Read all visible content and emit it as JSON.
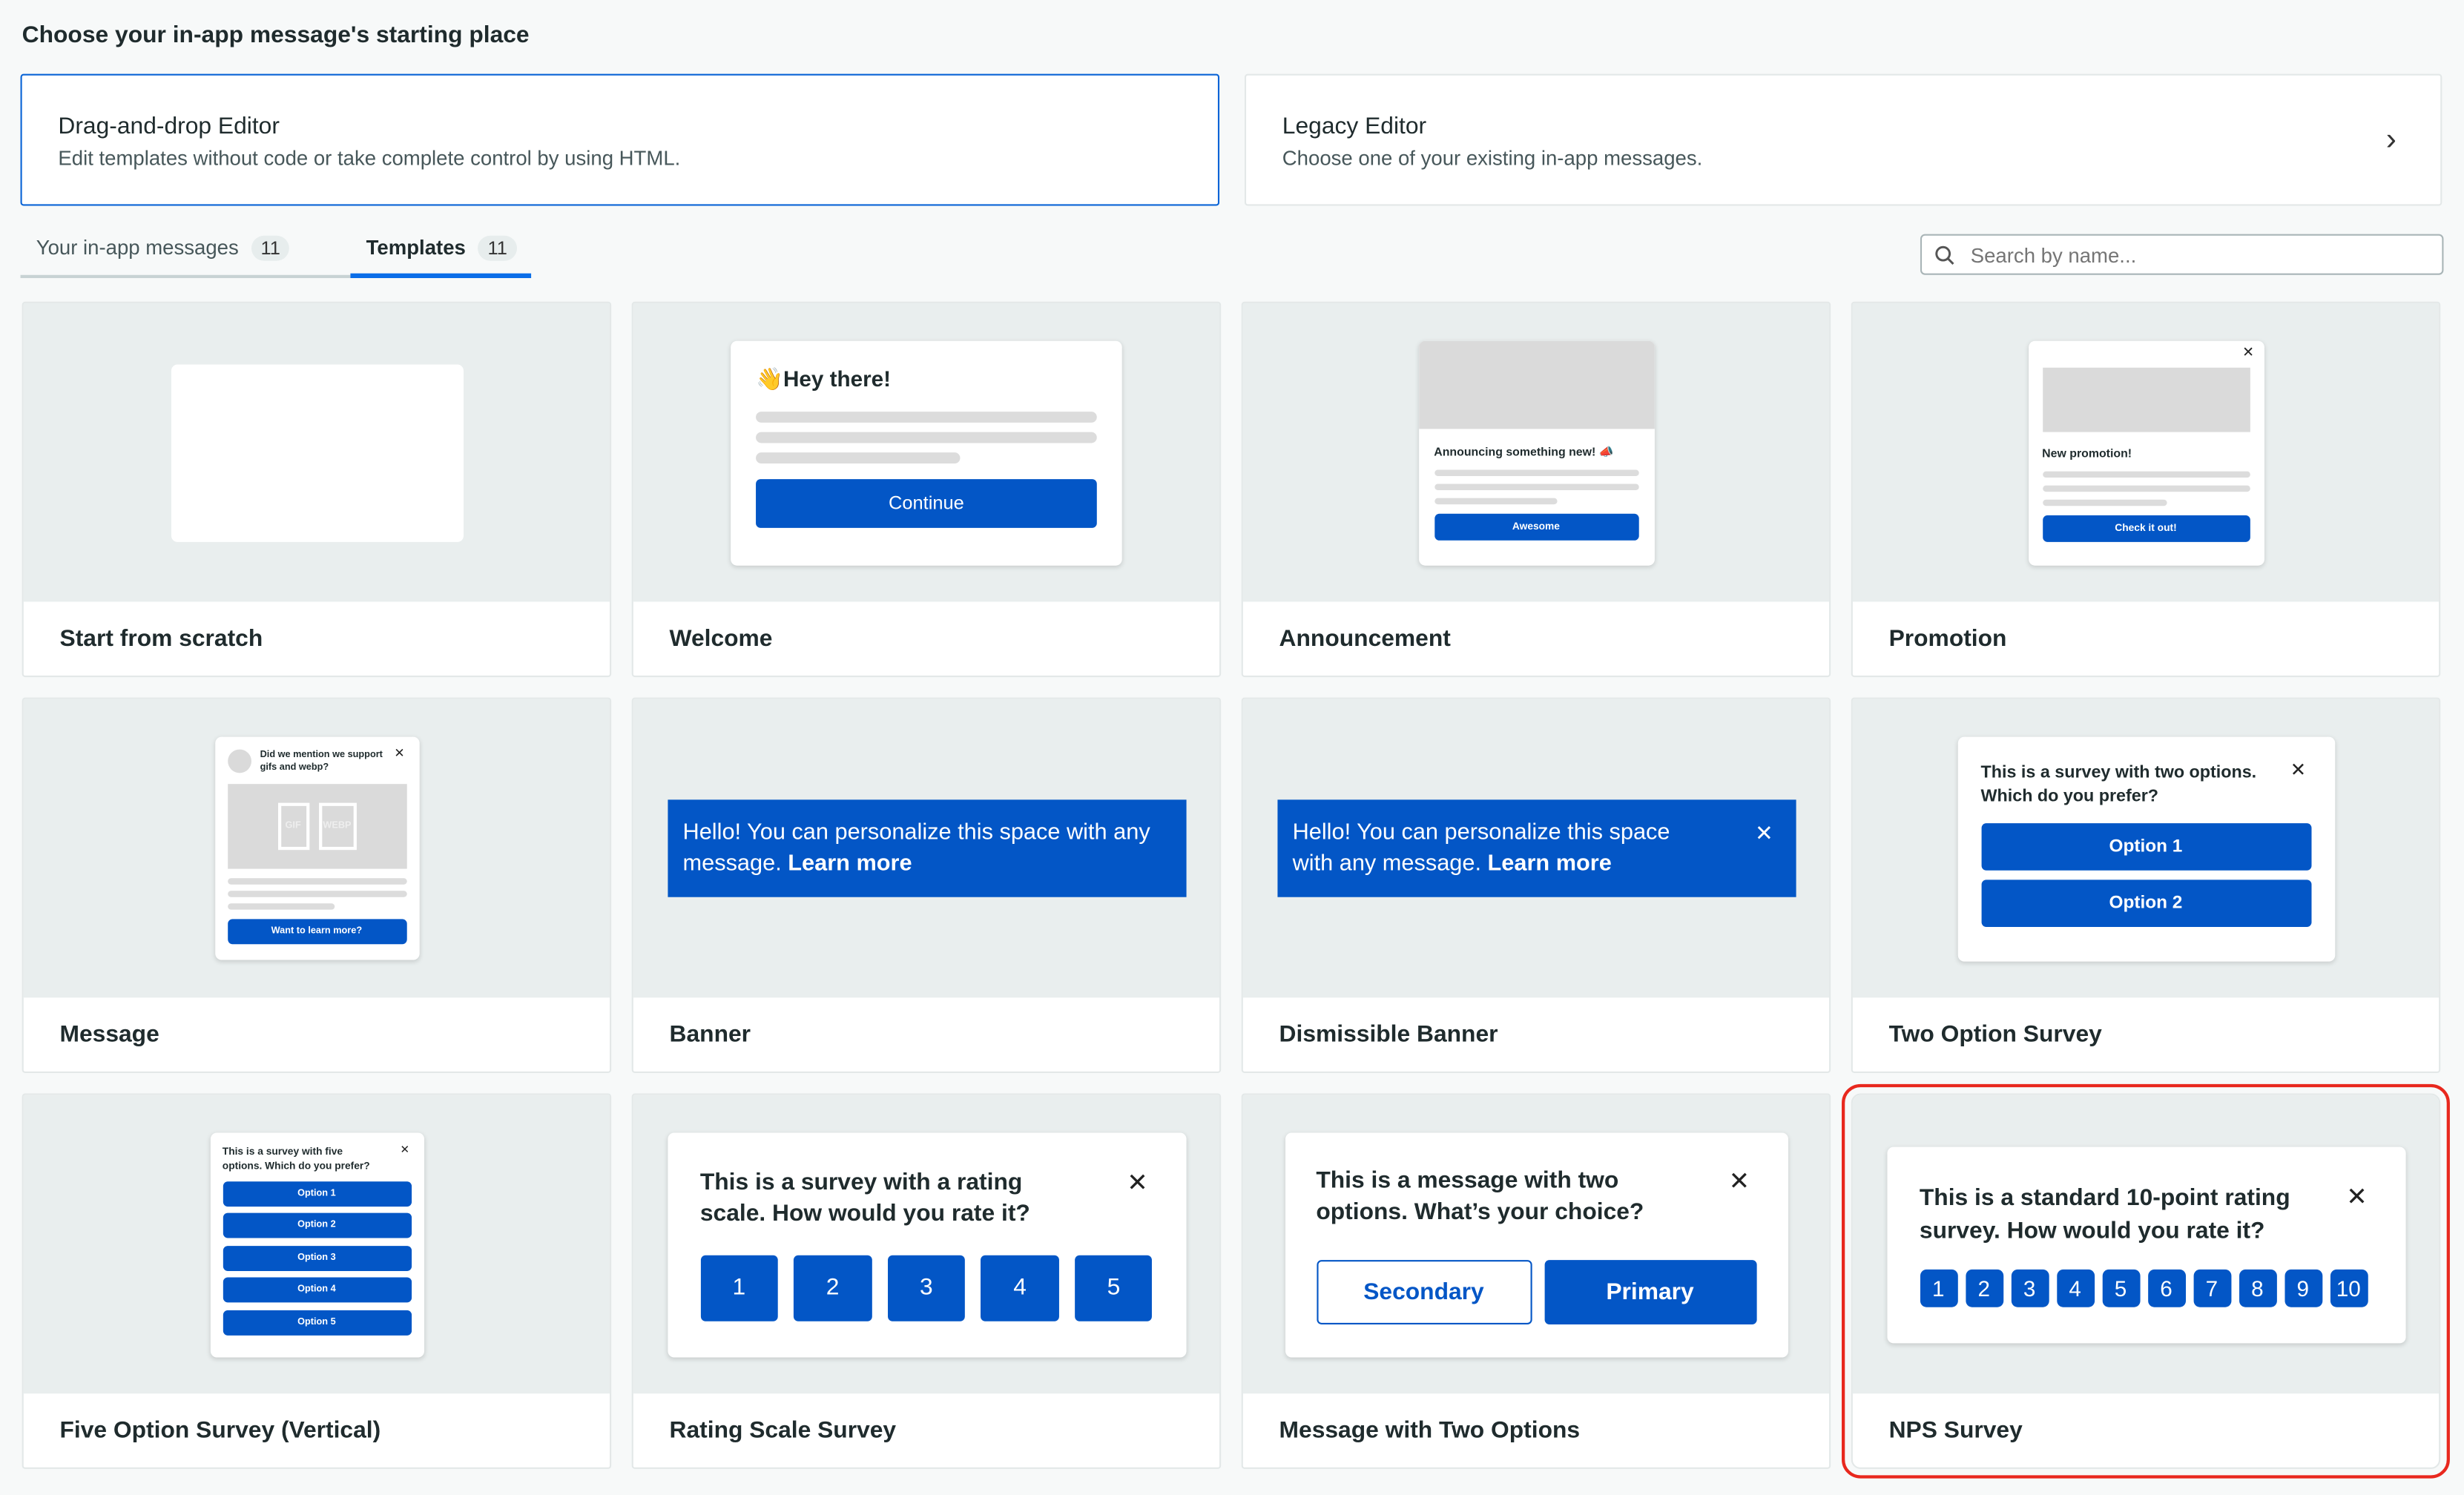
{
  "page_title": "Choose your in-app message's starting place",
  "editors": [
    {
      "title": "Drag-and-drop Editor",
      "desc": "Edit templates without code or take complete control by using HTML."
    },
    {
      "title": "Legacy Editor",
      "desc": "Choose one of your existing in-app messages."
    }
  ],
  "tabs": [
    {
      "label": "Your in-app messages",
      "count": "11"
    },
    {
      "label": "Templates",
      "count": "11"
    }
  ],
  "search": {
    "placeholder": "Search by name..."
  },
  "templates": [
    {
      "name": "Start from scratch"
    },
    {
      "name": "Welcome",
      "heading": "👋Hey there!",
      "button": "Continue"
    },
    {
      "name": "Announcement",
      "heading": "Announcing something new! 📣",
      "button": "Awesome"
    },
    {
      "name": "Promotion",
      "heading": "New promotion!",
      "button": "Check it out!"
    },
    {
      "name": "Message",
      "heading": "Did we mention we support gifs and webp?",
      "gif": "GIF",
      "webp": "WEBP",
      "button": "Want to learn more?"
    },
    {
      "name": "Banner",
      "text": "Hello! You can personalize this space with any message.",
      "link": "Learn more"
    },
    {
      "name": "Dismissible Banner",
      "text": "Hello! You can personalize this space with any message.",
      "link": "Learn more"
    },
    {
      "name": "Two Option Survey",
      "heading": "This is a survey with two options. Which do you prefer?",
      "options": [
        "Option 1",
        "Option 2"
      ]
    },
    {
      "name": "Five Option Survey (Vertical)",
      "heading": "This is a survey with five options. Which do you prefer?",
      "options": [
        "Option 1",
        "Option 2",
        "Option 3",
        "Option 4",
        "Option 5"
      ]
    },
    {
      "name": "Rating Scale Survey",
      "heading": "This is a survey with a rating scale. How would you rate it?",
      "options": [
        "1",
        "2",
        "3",
        "4",
        "5"
      ]
    },
    {
      "name": "Message with Two Options",
      "heading": "This is a message with two options. What’s your choice?",
      "secondary": "Secondary",
      "primary": "Primary"
    },
    {
      "name": "NPS Survey",
      "heading": "This is a standard 10-point rating survey. How would you rate it?",
      "options": [
        "1",
        "2",
        "3",
        "4",
        "5",
        "6",
        "7",
        "8",
        "9",
        "10"
      ]
    }
  ]
}
